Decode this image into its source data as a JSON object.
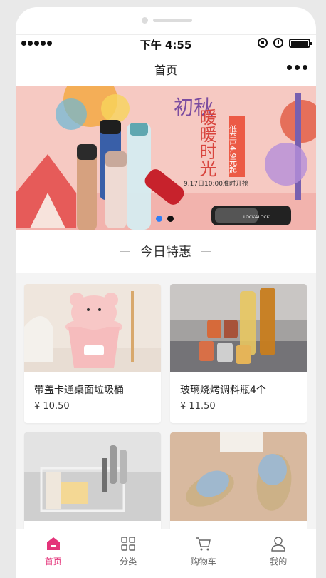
{
  "status_bar": {
    "time": "下午 4:55"
  },
  "nav": {
    "title": "首页"
  },
  "banner": {
    "heading_left": "初秋",
    "heading_right": "暖暖时光",
    "promo": "低至14.9元起",
    "start_time": "9.17日10:00准时开抢",
    "bottle_brand": "LOCK&LOCK",
    "carousel_dots": 2,
    "active_dot": 0,
    "colors": {
      "background": "#f6c9c2",
      "accent": "#e84a45",
      "dot_active": "#2f7ef5",
      "dot_inactive": "#111111"
    }
  },
  "section": {
    "title": "今日特惠"
  },
  "products": [
    {
      "name": "带盖卡通桌面垃圾桶",
      "price": "¥ 10.50"
    },
    {
      "name": "玻璃烧烤调料瓶4个",
      "price": "¥ 11.50"
    },
    {
      "name": "",
      "price": ""
    },
    {
      "name": "",
      "price": ""
    }
  ],
  "tabbar": {
    "items": [
      {
        "label": "首页",
        "icon": "home-icon",
        "active": true
      },
      {
        "label": "分类",
        "icon": "grid-icon",
        "active": false
      },
      {
        "label": "购物车",
        "icon": "cart-icon",
        "active": false
      },
      {
        "label": "我的",
        "icon": "user-icon",
        "active": false
      }
    ],
    "accent": "#e4337a"
  }
}
